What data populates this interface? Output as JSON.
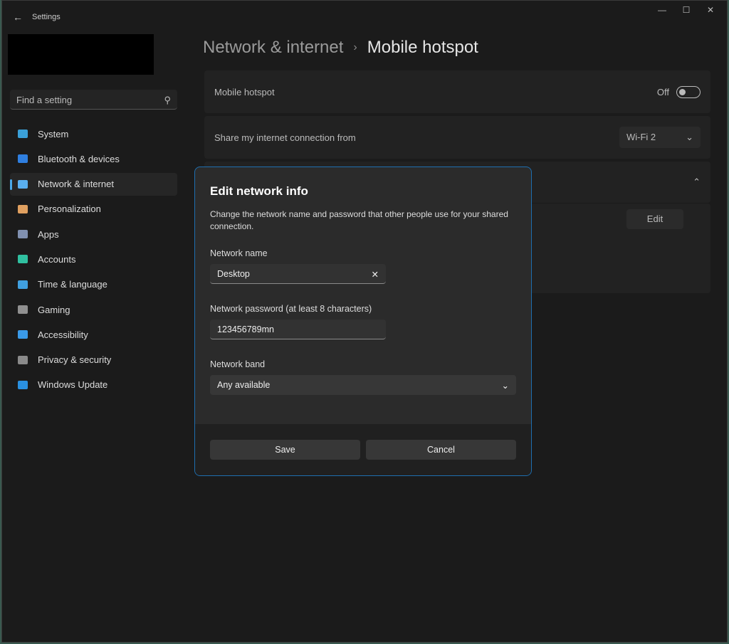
{
  "window": {
    "title": "Settings",
    "minimize": "—",
    "maximize": "☐",
    "close": "✕"
  },
  "search": {
    "placeholder": "Find a setting"
  },
  "nav": [
    {
      "label": "System",
      "color": "#3aa0d8"
    },
    {
      "label": "Bluetooth & devices",
      "color": "#2f7fe0"
    },
    {
      "label": "Network & internet",
      "color": "#5ab0f0",
      "active": true
    },
    {
      "label": "Personalization",
      "color": "#e0a060"
    },
    {
      "label": "Apps",
      "color": "#8090b0"
    },
    {
      "label": "Accounts",
      "color": "#30c0a0"
    },
    {
      "label": "Time & language",
      "color": "#40a0e0"
    },
    {
      "label": "Gaming",
      "color": "#909090"
    },
    {
      "label": "Accessibility",
      "color": "#3a9ae8"
    },
    {
      "label": "Privacy & security",
      "color": "#8a8a8a"
    },
    {
      "label": "Windows Update",
      "color": "#2a90e0"
    }
  ],
  "breadcrumb": {
    "parent": "Network & internet",
    "current": "Mobile hotspot"
  },
  "main": {
    "hotspot_label": "Mobile hotspot",
    "hotspot_state": "Off",
    "share_label": "Share my internet connection from",
    "share_value": "Wi-Fi 2",
    "edit_label": "Edit"
  },
  "dialog": {
    "title": "Edit network info",
    "description": "Change the network name and password that other people use for your shared connection.",
    "name_label": "Network name",
    "name_value": "Desktop",
    "password_label": "Network password (at least 8 characters)",
    "password_value": "123456789mn",
    "band_label": "Network band",
    "band_value": "Any available",
    "save": "Save",
    "cancel": "Cancel"
  }
}
